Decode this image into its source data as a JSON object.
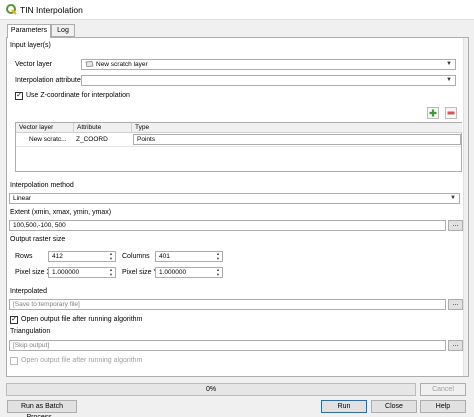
{
  "window": {
    "title": "TIN Interpolation",
    "icon": "qgis-logo-icon"
  },
  "tabs": [
    {
      "label": "Parameters",
      "active": true
    },
    {
      "label": "Log",
      "active": false
    }
  ],
  "input_layers": {
    "group_label": "Input layer(s)",
    "vector_layer_label": "Vector layer",
    "vector_layer_value": "New scratch layer",
    "interp_attr_label": "Interpolation attribute",
    "interp_attr_value": "",
    "use_z_label": "Use Z-coordinate for interpolation",
    "use_z_checked": true,
    "add_icon": "plus-icon",
    "remove_icon": "minus-icon",
    "table": {
      "headers": [
        "Vector layer",
        "Attribute",
        "Type"
      ],
      "rows": [
        {
          "layer": "New scratc...",
          "attribute": "Z_COORD",
          "type": "Points"
        }
      ]
    }
  },
  "interpolation_method": {
    "label": "Interpolation method",
    "value": "Linear"
  },
  "extent": {
    "label": "Extent (xmin, xmax, ymin, ymax)",
    "value": "100,500,-100, 500"
  },
  "raster_size": {
    "label": "Output raster size",
    "rows_label": "Rows",
    "rows_value": "412",
    "columns_label": "Columns",
    "columns_value": "401",
    "pixel_x_label": "Pixel size X",
    "pixel_x_value": "1.000000",
    "pixel_y_label": "Pixel size Y",
    "pixel_y_value": "1.000000"
  },
  "interpolated": {
    "label": "Interpolated",
    "placeholder": "[Save to temporary file]",
    "open_after_label": "Open output file after running algorithm",
    "open_after_checked": true
  },
  "triangulation": {
    "label": "Triangulation",
    "placeholder": "[Skip output]",
    "open_after_label": "Open output file after running algorithm",
    "open_after_checked": false
  },
  "browse_label": "...",
  "progress": {
    "text": "0%",
    "value": 0
  },
  "buttons": {
    "cancel": "Cancel",
    "batch": "Run as Batch Process...",
    "run": "Run",
    "close": "Close",
    "help": "Help"
  }
}
